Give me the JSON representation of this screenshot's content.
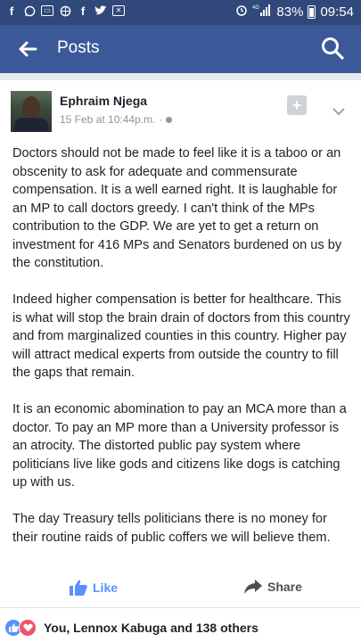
{
  "status_bar": {
    "left_icons": [
      "facebook-icon",
      "whatsapp-icon",
      "mail-icon",
      "browser-icon",
      "facebook-icon",
      "twitter-icon",
      "box-icon"
    ],
    "battery": "83%",
    "time": "09:54"
  },
  "app_bar": {
    "title": "Posts"
  },
  "post": {
    "author": "Ephraim Njega",
    "timestamp": "15 Feb at 10:44p.m.",
    "paragraphs": [
      "Doctors should not be made to feel like it is a taboo or an obscenity to ask for adequate and commensurate compensation. It is a well earned right. It is laughable for an MP to call doctors greedy. I can't think of the MPs contribution to the GDP. We are yet to get a return on investment for 416 MPs and Senators burdened on us by the constitution.",
      "Indeed higher compensation is better for healthcare. This is what will stop the brain drain of doctors from this country and from marginalized counties in this country. Higher pay will attract medical experts from outside the country to fill the gaps that remain.",
      "It is an economic abomination to pay an MCA more than a doctor. To pay an MP more than a University professor is an atrocity. The distorted public pay system where politicians live like gods and citizens like dogs is catching up with us.",
      "The day Treasury tells politicians there is no money for their routine raids of public coffers we will believe them."
    ]
  },
  "actions": {
    "like_label": "Like",
    "share_label": "Share"
  },
  "reactions": {
    "summary": "You, Lennox Kabuga and 138 others"
  },
  "colors": {
    "status_bar": "#30487a",
    "app_bar": "#3b5998",
    "like_blue": "#5890ff",
    "love_red": "#f25268"
  }
}
